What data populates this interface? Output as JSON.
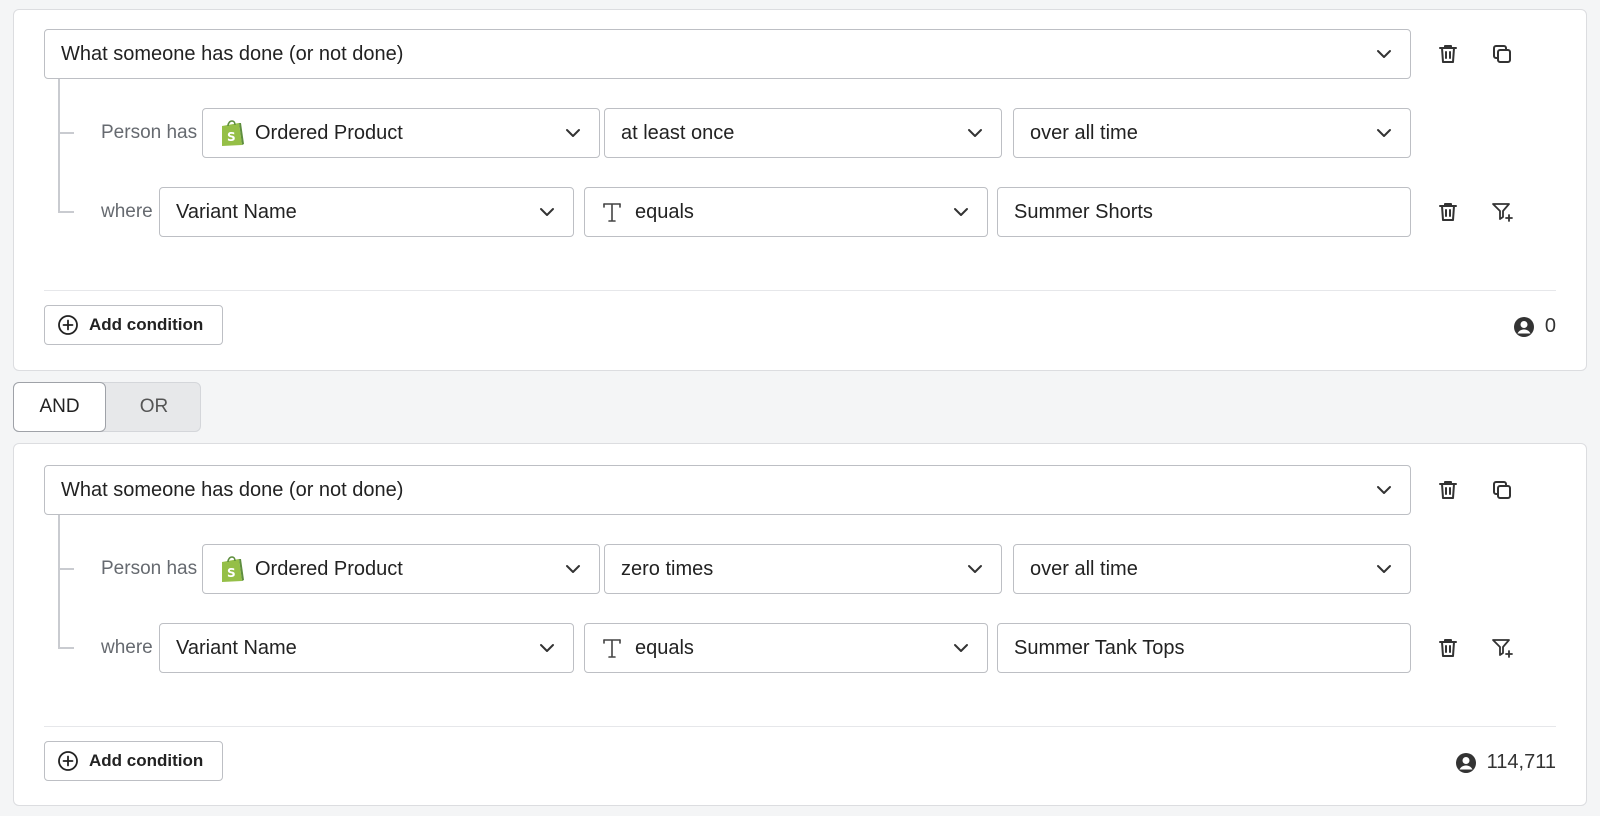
{
  "groups": [
    {
      "type_select": "What someone has done (or not done)",
      "person_has_label": "Person has",
      "metric": "Ordered Product",
      "frequency": "at least once",
      "timeframe": "over all time",
      "where_label": "where",
      "property": "Variant Name",
      "operator": "equals",
      "value": "Summer Shorts",
      "add_condition_label": "Add condition",
      "profile_count": "0"
    },
    {
      "type_select": "What someone has done (or not done)",
      "person_has_label": "Person has",
      "metric": "Ordered Product",
      "frequency": "zero times",
      "timeframe": "over all time",
      "where_label": "where",
      "property": "Variant Name",
      "operator": "equals",
      "value": "Summer Tank Tops",
      "add_condition_label": "Add condition",
      "profile_count": "114,711"
    }
  ],
  "logic_toggle": {
    "and_label": "AND",
    "or_label": "OR",
    "selected": "AND"
  },
  "icons": {
    "delete": "trash-icon",
    "duplicate": "copy-icon",
    "add_filter": "filter-plus-icon",
    "add": "plus-circle-icon",
    "profile": "user-circle-icon",
    "metric_source": "shopify-bag-icon",
    "text_type": "text-type-icon",
    "dropdown": "chevron-down-icon"
  },
  "colors": {
    "shopify_green": "#95BF47",
    "border": "#BDBFC4",
    "background": "#F4F5F6"
  }
}
